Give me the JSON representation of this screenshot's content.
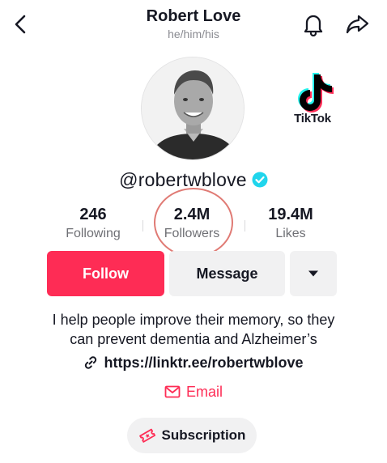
{
  "header": {
    "title": "Robert Love",
    "pronouns": "he/him/his",
    "icons": {
      "back": "chevron-left-icon",
      "notifications": "bell-icon",
      "share": "share-arrow-icon"
    }
  },
  "profile": {
    "handle": "@robertwblove",
    "verified": true,
    "verified_color": "#20d5ec",
    "logo_text": "TikTok"
  },
  "stats": [
    {
      "value": "246",
      "label": "Following"
    },
    {
      "value": "2.4M",
      "label": "Followers"
    },
    {
      "value": "19.4M",
      "label": "Likes"
    }
  ],
  "actions": {
    "follow_label": "Follow",
    "message_label": "Message",
    "more_icon": "caret-down-icon"
  },
  "bio": {
    "line1": "I help people improve their memory, so they",
    "line2": "can prevent dementia and Alzheimer’s"
  },
  "link": {
    "text": "https://linktr.ee/robertwblove",
    "icon": "link-icon"
  },
  "email": {
    "label": "Email",
    "icon": "envelope-icon"
  },
  "subscription": {
    "label": "Subscription",
    "icon": "ticket-icon"
  },
  "colors": {
    "accent": "#fe2c55",
    "text": "#161823",
    "muted": "#6f7075",
    "button_bg": "#f1f1f2",
    "highlight_circle": "#e07a74"
  }
}
